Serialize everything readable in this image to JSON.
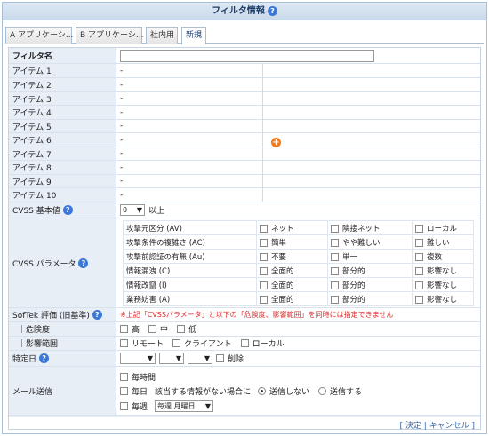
{
  "title": "フィルタ情報",
  "tabs": [
    "A アプリケーシ...",
    "B アプリケーシ...",
    "社内用",
    "新規"
  ],
  "filter_name_label": "フィルタ名",
  "filter_name_value": "",
  "items": [
    {
      "label": "アイテム 1",
      "value": "-"
    },
    {
      "label": "アイテム 2",
      "value": "-"
    },
    {
      "label": "アイテム 3",
      "value": "-"
    },
    {
      "label": "アイテム 4",
      "value": "-"
    },
    {
      "label": "アイテム 5",
      "value": "-"
    },
    {
      "label": "アイテム 6",
      "value": "-"
    },
    {
      "label": "アイテム 7",
      "value": "-"
    },
    {
      "label": "アイテム 8",
      "value": "-"
    },
    {
      "label": "アイテム 9",
      "value": "-"
    },
    {
      "label": "アイテム 10",
      "value": "-"
    }
  ],
  "cvss_base": {
    "label": "CVSS 基本値",
    "select_value": "0",
    "suffix": "以上"
  },
  "cvss_params": {
    "label": "CVSS パラメータ",
    "rows": [
      {
        "name": "攻撃元区分 (AV)",
        "options": [
          "ネット",
          "隣接ネット",
          "ローカル"
        ]
      },
      {
        "name": "攻撃条件の複雑さ (AC)",
        "options": [
          "簡単",
          "やや難しい",
          "難しい"
        ]
      },
      {
        "name": "攻撃前認証の有無 (Au)",
        "options": [
          "不要",
          "単一",
          "複数"
        ]
      },
      {
        "name": "情報漏洩 (C)",
        "options": [
          "全面的",
          "部分的",
          "影響なし"
        ]
      },
      {
        "name": "情報改竄 (I)",
        "options": [
          "全面的",
          "部分的",
          "影響なし"
        ]
      },
      {
        "name": "業務妨害 (A)",
        "options": [
          "全面的",
          "部分的",
          "影響なし"
        ]
      }
    ]
  },
  "softek": {
    "label": "SofTek 評価 (旧基準)",
    "warning": "※上記「CVSSパラメータ」と以下の「危険度、影響範囲」を同時には指定できません"
  },
  "risk": {
    "label": "｜危険度",
    "options": [
      "高",
      "中",
      "低"
    ]
  },
  "scope": {
    "label": "｜影響範囲",
    "options": [
      "リモート",
      "クライアント",
      "ローカル"
    ]
  },
  "date": {
    "label": "特定日",
    "delete": "削除"
  },
  "mail": {
    "label": "メール送信",
    "hourly": "毎時間",
    "daily": "毎日",
    "no_info": "該当する情報がない場合に",
    "no_send": "送信しない",
    "send": "送信する",
    "weekly": "毎週",
    "weekday": "毎週 月曜日"
  },
  "footer": {
    "ok": "決定",
    "cancel": "キャンセル"
  },
  "colors": {
    "accent": "#1b3a66",
    "label_bg": "#e8eef6",
    "warning": "#e02b2b",
    "add_button": "#f07c21"
  }
}
